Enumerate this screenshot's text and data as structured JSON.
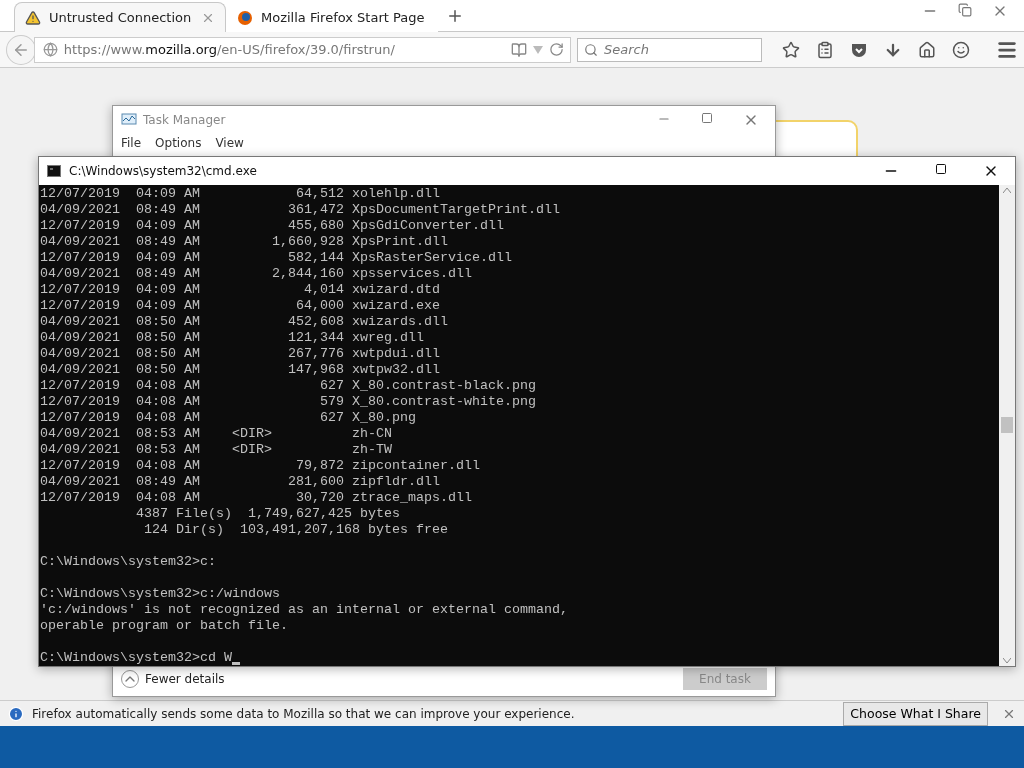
{
  "browser": {
    "tabs": [
      {
        "title": "Untrusted Connection",
        "kind": "warning",
        "selected": true
      },
      {
        "title": "Mozilla Firefox Start Page",
        "kind": "firefox",
        "selected": false
      }
    ],
    "url": "https://www.**mozilla.org**/en-US/firefox/39.0/firstrun/",
    "search": {
      "placeholder": "Search"
    }
  },
  "task_manager": {
    "title": "Task Manager",
    "menu": [
      "File",
      "Options",
      "View"
    ],
    "details_toggle": "Fewer details",
    "end_task": {
      "label": "End task",
      "disabled": true
    }
  },
  "cmd": {
    "title": "C:\\Windows\\system32\\cmd.exe",
    "blocks": [
      [
        "12/07/2019  04:09 AM            64,512 xolehlp.dll",
        "04/09/2021  08:49 AM           361,472 XpsDocumentTargetPrint.dll",
        "12/07/2019  04:09 AM           455,680 XpsGdiConverter.dll",
        "04/09/2021  08:49 AM         1,660,928 XpsPrint.dll",
        "12/07/2019  04:09 AM           582,144 XpsRasterService.dll",
        "04/09/2021  08:49 AM         2,844,160 xpsservices.dll",
        "12/07/2019  04:09 AM             4,014 xwizard.dtd",
        "12/07/2019  04:09 AM            64,000 xwizard.exe",
        "04/09/2021  08:50 AM           452,608 xwizards.dll",
        "04/09/2021  08:50 AM           121,344 xwreg.dll",
        "04/09/2021  08:50 AM           267,776 xwtpdui.dll",
        "04/09/2021  08:50 AM           147,968 xwtpw32.dll",
        "12/07/2019  04:08 AM               627 X_80.contrast-black.png",
        "12/07/2019  04:08 AM               579 X_80.contrast-white.png",
        "12/07/2019  04:08 AM               627 X_80.png",
        "04/09/2021  08:53 AM    <DIR>          zh-CN",
        "04/09/2021  08:53 AM    <DIR>          zh-TW",
        "12/07/2019  04:08 AM            79,872 zipcontainer.dll",
        "04/09/2021  08:49 AM           281,600 zipfldr.dll",
        "12/07/2019  04:08 AM            30,720 ztrace_maps.dll",
        "            4387 File(s)  1,749,627,425 bytes",
        "             124 Dir(s)  103,491,207,168 bytes free"
      ],
      [
        "C:\\Windows\\system32>c:"
      ],
      [
        "C:\\Windows\\system32>c:/windows",
        "'c:/windows' is not recognized as an internal or external command,",
        "operable program or batch file."
      ],
      [
        "C:\\Windows\\system32>cd W"
      ]
    ]
  },
  "notification": {
    "message": "Firefox automatically sends some data to Mozilla so that we can improve your experience.",
    "button": "Choose What I Share"
  }
}
